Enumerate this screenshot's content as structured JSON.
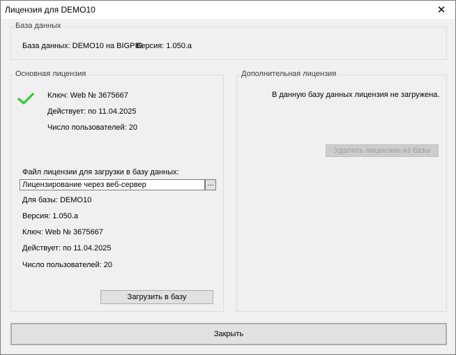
{
  "window": {
    "title": "Лицензия для DEMO10",
    "close_glyph": "✕"
  },
  "database_group": {
    "title": "База данных",
    "info": "База данных: DEMO10 на BIGPIG",
    "version": "Версия: 1.050.a"
  },
  "main_license": {
    "title": "Основная лицензия",
    "status_icon": "check-icon",
    "status_color": "#2ecc2e",
    "key": "Ключ: Web № 3675667",
    "valid": "Действует: по 11.04.2025",
    "users": "Число пользователей: 20",
    "file_label": "Файл лицензии для загрузки в базу данных:",
    "file_value": "Лицензирование через веб-сервер",
    "browse_label": "...",
    "file_info": {
      "db": "Для базы: DEMO10",
      "version": "Версия: 1.050.a",
      "key": "Ключ: Web № 3675667",
      "valid": "Действует: по 11.04.2025",
      "users": "Число пользователей: 20"
    },
    "load_button": "Загрузить в базу"
  },
  "extra_license": {
    "title": "Дополнительная лицензия",
    "message": "В данную базу данных лицензия не загружена.",
    "delete_button": "Удалить лицензию из базы"
  },
  "footer": {
    "close_button": "Закрыть"
  }
}
